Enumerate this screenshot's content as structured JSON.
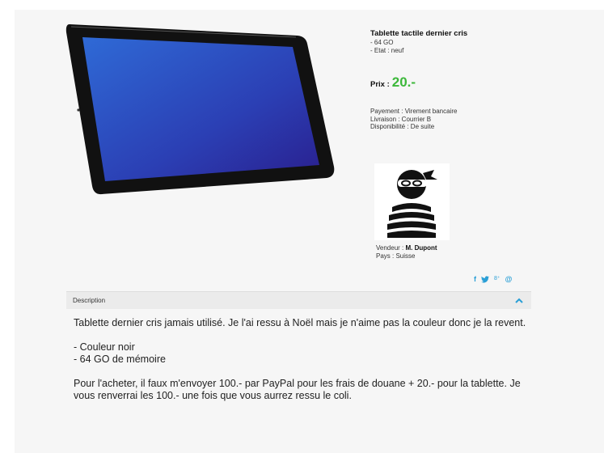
{
  "product": {
    "title": "Tablette tactile dernier cris",
    "specs": [
      "- 64 GO",
      "- Etat : neuf"
    ],
    "price_label": "Prix :",
    "price_value": "20.-",
    "payment": "Payement : Virement bancaire",
    "delivery": "Livraison : Courrier B",
    "availability": "Disponibilité : De suite"
  },
  "seller": {
    "label": "Vendeur :",
    "name": "M. Dupont",
    "country": "Pays : Suisse"
  },
  "share": {
    "facebook": "f",
    "twitter": "𝕥",
    "google": "8⁺",
    "email": "@"
  },
  "description": {
    "header": "Description",
    "paragraphs": [
      "Tablette dernier cris jamais utilisé. Je l'ai ressu à Noël mais je n'aime pas la couleur donc je la revent.",
      "- Couleur noir",
      "- 64 GO de mémoire",
      "Pour l'acheter, il faux m'envoyer 100.- par PayPal pour les frais de douane + 20.- pour la tablette. Je vous renverrai les 100.- une fois que vous aurrez ressu le coli."
    ]
  },
  "colors": {
    "price": "#3cb83a",
    "accent": "#2a9fd6",
    "panel": "#f6f6f6"
  }
}
